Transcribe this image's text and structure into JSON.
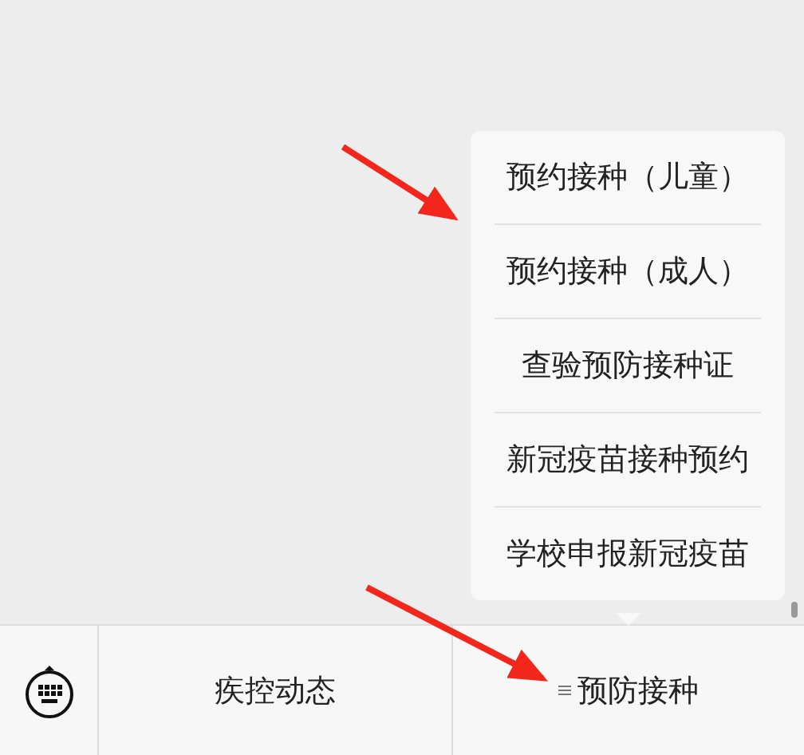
{
  "popup_menu": {
    "items": [
      {
        "label": "预约接种（儿童）"
      },
      {
        "label": "预约接种（成人）"
      },
      {
        "label": "查验预防接种证"
      },
      {
        "label": "新冠疫苗接种预约"
      },
      {
        "label": "学校申报新冠疫苗"
      }
    ]
  },
  "menu_bar": {
    "items": [
      {
        "label": "疾控动态",
        "submenu": false
      },
      {
        "label": "预防接种",
        "submenu": true
      }
    ]
  }
}
